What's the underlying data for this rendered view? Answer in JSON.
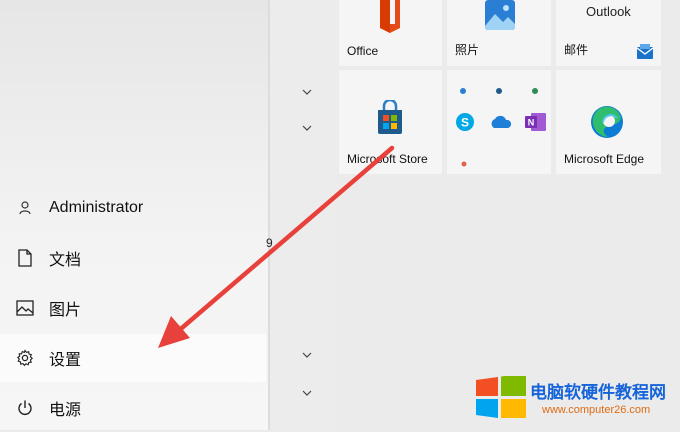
{
  "start_menu": {
    "user": {
      "name": "Administrator",
      "icon": "user-icon"
    },
    "nav": [
      {
        "label": "文档",
        "icon": "document-icon"
      },
      {
        "label": "图片",
        "icon": "picture-icon"
      },
      {
        "label": "设置",
        "icon": "gear-icon"
      },
      {
        "label": "电源",
        "icon": "power-icon"
      }
    ],
    "app_list": {
      "number_label": "9"
    }
  },
  "tiles": {
    "office": {
      "label": "Office"
    },
    "photos": {
      "label": "照片"
    },
    "mail": {
      "label": "邮件",
      "top_text": "Outlook"
    },
    "store": {
      "label": "Microsoft Store"
    },
    "edge": {
      "label": "Microsoft Edge"
    }
  },
  "watermark": {
    "title": "电脑软硬件教程网",
    "url": "www.computer26.com"
  },
  "colors": {
    "accent_arrow": "#e8403a",
    "office_red": "#d83b01",
    "edge_blue": "#0c7cd5",
    "watermark_blue": "#1664d9"
  }
}
